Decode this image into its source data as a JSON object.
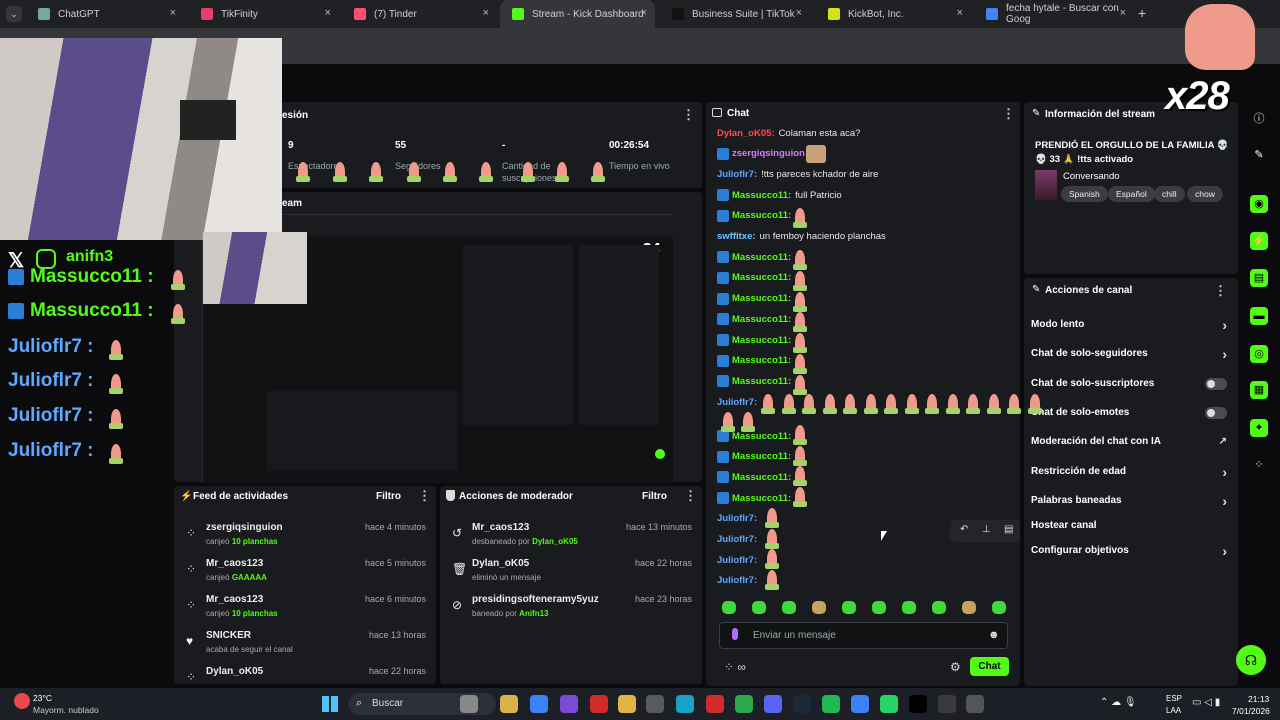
{
  "browser": {
    "tabs": [
      {
        "label": "ChatGPT",
        "color": "#74aa9c"
      },
      {
        "label": "TikFinity",
        "color": "#e63f6c"
      },
      {
        "label": "(7) Tinder",
        "color": "#ff4d6d"
      },
      {
        "label": "Stream - Kick Dashboard",
        "color": "#53fc18"
      },
      {
        "label": "Business Suite | TikTok",
        "color": "#111111"
      },
      {
        "label": "KickBot, Inc.",
        "color": "#d4e21c"
      },
      {
        "label": "fecha hytale - Buscar con Goog",
        "color": "#4285f4"
      }
    ],
    "new_tab": "+"
  },
  "overlay": {
    "handle": "anifn3",
    "counter": "x28",
    "rows": [
      {
        "user": "Massucco11 :",
        "color": "#53fc18"
      },
      {
        "user": "Massucco11 :",
        "color": "#53fc18"
      },
      {
        "user": "Julioflr7 :",
        "color": "#5fa8ff"
      },
      {
        "user": "Julioflr7 :",
        "color": "#5fa8ff"
      },
      {
        "user": "Julioflr7 :",
        "color": "#5fa8ff"
      },
      {
        "user": "Julioflr7 :",
        "color": "#5fa8ff"
      }
    ]
  },
  "session": {
    "title": "esión",
    "stats": [
      {
        "value": "9",
        "label": "Espectadores"
      },
      {
        "value": "55",
        "label": "Seguidores"
      },
      {
        "value": "-",
        "label": "Cantidad de suscripciones"
      },
      {
        "value": "00:26:54",
        "label": "Tiempo en vivo"
      }
    ]
  },
  "stream_preview": {
    "title": "eam",
    "counter": "x24"
  },
  "feed": {
    "title": "Feed de actividades",
    "filter": "Filtro",
    "items": [
      {
        "name": "zsergiqsinguion",
        "action": "canjeó",
        "highlight": "10 planchas",
        "time": "hace 4 minutos"
      },
      {
        "name": "Mr_caos123",
        "action": "canjeó",
        "highlight": "GAAAAA",
        "time": "hace 5 minutos"
      },
      {
        "name": "Mr_caos123",
        "action": "canjeó",
        "highlight": "10 planchas",
        "time": "hace 6 minutos"
      },
      {
        "name": "SNICKER",
        "action": "acaba de seguir el canal",
        "highlight": "",
        "time": "hace 13 horas"
      },
      {
        "name": "Dylan_oK05",
        "action": "",
        "highlight": "",
        "time": "hace 22 horas"
      }
    ]
  },
  "mod": {
    "title": "Acciones de moderador",
    "filter": "Filtro",
    "items": [
      {
        "name": "Mr_caos123",
        "action": "desbaneado por",
        "by": "Dylan_oK05",
        "time": "hace 13 minutos"
      },
      {
        "name": "Dylan_oK05",
        "action": "eliminó un mensaje",
        "by": "",
        "time": "hace 22 horas"
      },
      {
        "name": "presidingsofteneramy5yuz",
        "action": "baneado por",
        "by": "Anifn13",
        "time": "hace 23 horas"
      }
    ]
  },
  "chat": {
    "title": "Chat",
    "messages": [
      {
        "user": "Dylan_oK05:",
        "cls": "u-red",
        "text": "Colaman esta aca?",
        "badge": false
      },
      {
        "user": "zsergiqsinguion:",
        "cls": "u-mag",
        "text": "",
        "badge": true
      },
      {
        "user": "Julioflr7:",
        "cls": "u-blue",
        "text": "!tts pareces kchador de aire",
        "badge": false
      },
      {
        "user": "Massucco11:",
        "cls": "u-green",
        "text": "full Patricio",
        "badge": true
      },
      {
        "user": "Massucco11:",
        "cls": "u-green",
        "text": "",
        "badge": true
      },
      {
        "user": "swffitxe:",
        "cls": "u-lb",
        "text": "un femboy haciendo planchas",
        "badge": false
      },
      {
        "user": "Massucco11:",
        "cls": "u-green",
        "text": "",
        "badge": true
      },
      {
        "user": "Massucco11:",
        "cls": "u-green",
        "text": "",
        "badge": true
      },
      {
        "user": "Massucco11:",
        "cls": "u-green",
        "text": "",
        "badge": true
      },
      {
        "user": "Massucco11:",
        "cls": "u-green",
        "text": "",
        "badge": true
      },
      {
        "user": "Massucco11:",
        "cls": "u-green",
        "text": "",
        "badge": true
      },
      {
        "user": "Massucco11:",
        "cls": "u-green",
        "text": "",
        "badge": true
      },
      {
        "user": "Massucco11:",
        "cls": "u-green",
        "text": "",
        "badge": true
      }
    ],
    "messages2": [
      {
        "user": "Massucco11:",
        "cls": "u-green"
      },
      {
        "user": "Massucco11:",
        "cls": "u-green"
      },
      {
        "user": "Massucco11:",
        "cls": "u-green"
      },
      {
        "user": "Massucco11:",
        "cls": "u-green"
      },
      {
        "user": "Julioflr7:",
        "cls": "u-blue"
      },
      {
        "user": "Julioflr7:",
        "cls": "u-blue"
      },
      {
        "user": "Julioflr7:",
        "cls": "u-blue"
      },
      {
        "user": "Julioflr7:",
        "cls": "u-blue"
      }
    ],
    "long_user": "Julioflr7:",
    "input_placeholder": "Enviar un mensaje",
    "send_label": "Chat"
  },
  "info": {
    "title": "Información del stream",
    "stream_title": "PRENDIÓ EL ORGULLO DE LA FAMILIA 💀 💀 33 🙏 !tts activado",
    "category": "Conversando",
    "tags": [
      "Spanish",
      "Español",
      "chill",
      "chow"
    ]
  },
  "actions": {
    "title": "Acciones de canal",
    "items": [
      {
        "label": "Modo lento",
        "kind": "chevron"
      },
      {
        "label": "Chat de solo-seguidores",
        "kind": "chevron"
      },
      {
        "label": "Chat de solo-suscriptores",
        "kind": "toggle"
      },
      {
        "label": "Chat de solo-emotes",
        "kind": "toggle"
      },
      {
        "label": "Moderación del chat con IA",
        "kind": "external"
      },
      {
        "label": "Restricción de edad",
        "kind": "chevron"
      },
      {
        "label": "Palabras baneadas",
        "kind": "chevron"
      },
      {
        "label": "Hostear canal",
        "kind": "none"
      },
      {
        "label": "Configurar objetivos",
        "kind": "chevron"
      }
    ]
  },
  "taskbar": {
    "weather_temp": "23°C",
    "weather_desc": "Mayorm. nublado",
    "search": "Buscar",
    "lang1": "ESP",
    "lang2": "LAA",
    "time": "21:13",
    "date": "7/01/2026"
  }
}
